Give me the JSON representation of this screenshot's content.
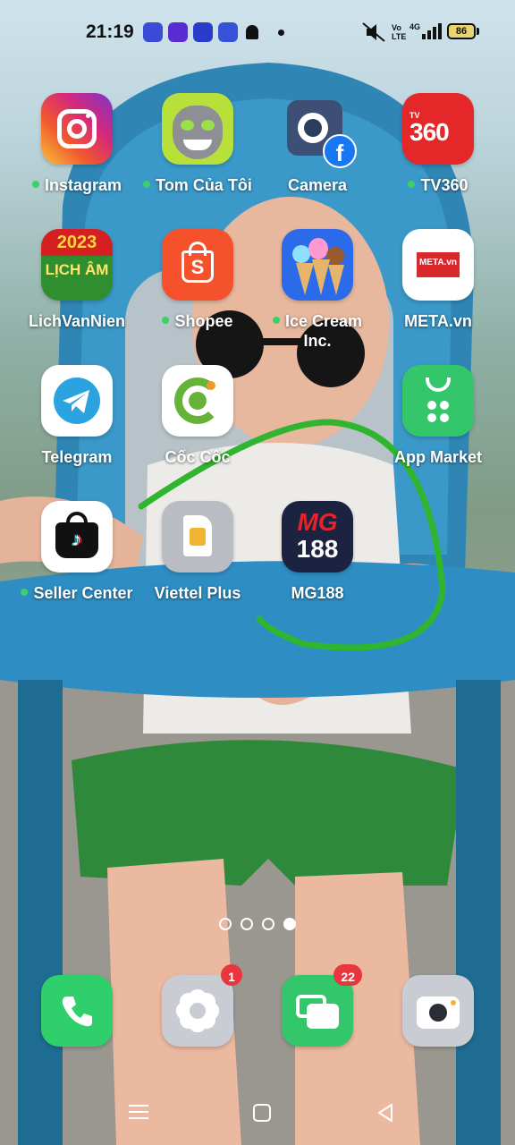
{
  "status_bar": {
    "time": "21:19",
    "network": "4G",
    "volte": "Vo LTE",
    "battery": "86",
    "notification_icons": [
      "hotspot-icon",
      "game-icon",
      "controller-icon",
      "calendar-sale-icon",
      "bell-icon",
      "dot-icon"
    ],
    "system_icons": [
      "mute-icon",
      "volte-icon",
      "signal-icon",
      "battery-icon"
    ]
  },
  "apps": [
    {
      "label": "Instagram",
      "dot": true,
      "icon": "instagram-icon"
    },
    {
      "label": "Tom Của Tôi",
      "dot": true,
      "icon": "talking-tom-icon"
    },
    {
      "label": "Camera",
      "dot": false,
      "icon": "facebook-camera-icon"
    },
    {
      "label": "TV360",
      "dot": true,
      "icon": "tv360-icon",
      "logo_text": "360",
      "small_text": "TV"
    },
    {
      "label": "LichVanNien",
      "dot": false,
      "icon": "calendar-icon",
      "logo_text": "2023",
      "sub_text": "LỊCH ÂM"
    },
    {
      "label": "Shopee",
      "dot": true,
      "icon": "shopee-icon"
    },
    {
      "label": "Ice Cream Inc.",
      "dot": true,
      "icon": "ice-cream-icon"
    },
    {
      "label": "META.vn",
      "dot": false,
      "icon": "meta-vn-icon",
      "logo_text": "META.vn"
    },
    {
      "label": "Telegram",
      "dot": false,
      "icon": "telegram-icon"
    },
    {
      "label": "Cốc Cốc",
      "dot": false,
      "icon": "coccoc-icon"
    },
    {
      "label": "App Market",
      "dot": false,
      "icon": "app-market-icon"
    },
    {
      "label": "Seller Center",
      "dot": true,
      "icon": "tiktok-seller-icon"
    },
    {
      "label": "Viettel Plus",
      "dot": false,
      "icon": "sim-card-icon"
    },
    {
      "label": "MG188",
      "dot": false,
      "icon": "mg188-icon",
      "logo_text": "MG",
      "logo_num": "188"
    }
  ],
  "pager": {
    "count": 4,
    "active_index": 3
  },
  "dock": [
    {
      "name": "phone",
      "icon": "phone-icon",
      "badge": ""
    },
    {
      "name": "settings",
      "icon": "settings-gear-icon",
      "badge": "1"
    },
    {
      "name": "messages",
      "icon": "messages-icon",
      "badge": "22"
    },
    {
      "name": "camera",
      "icon": "camera-icon",
      "badge": ""
    }
  ],
  "nav": [
    "menu-icon",
    "home-icon",
    "back-icon"
  ],
  "colors": {
    "notification_dot": "#3ad16b",
    "badge": "#e9353d",
    "annotation_stroke": "#2fb52f"
  }
}
